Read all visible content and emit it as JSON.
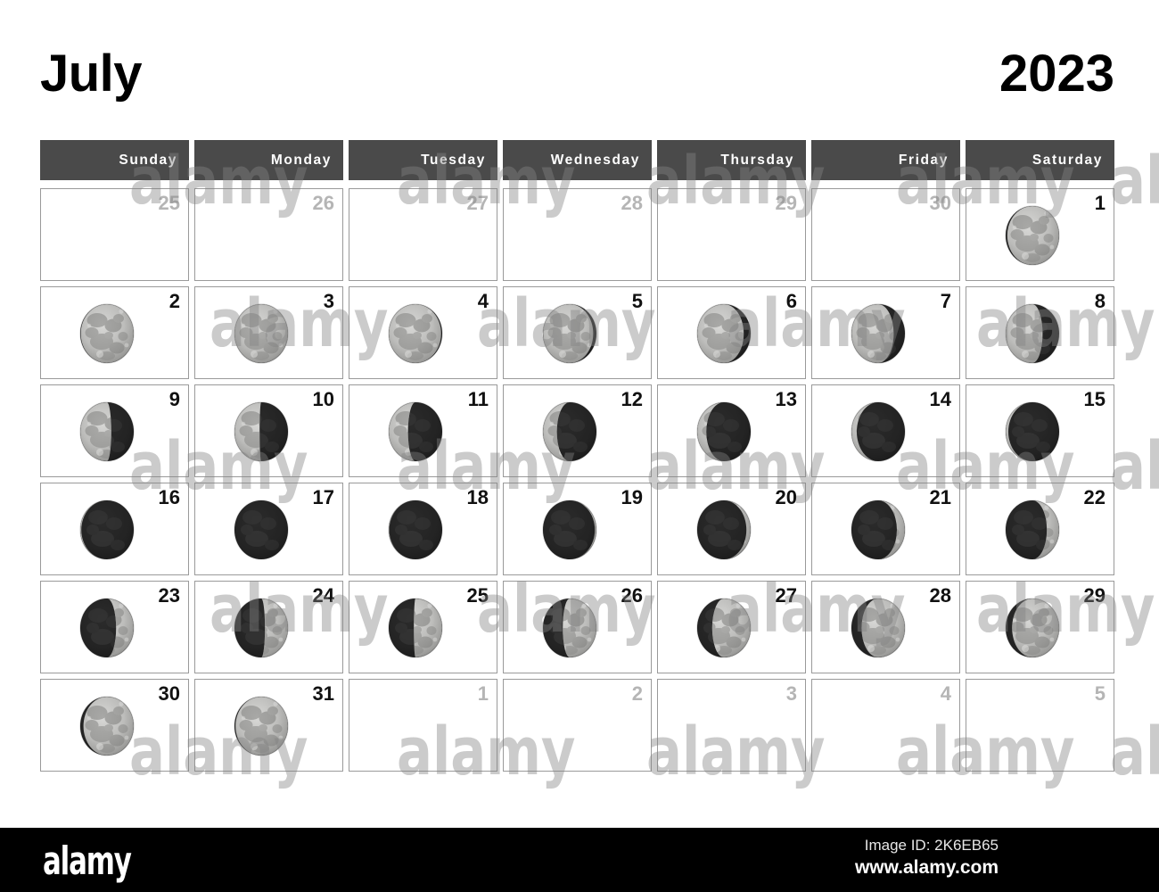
{
  "header": {
    "month": "July",
    "year": "2023"
  },
  "weekdays": [
    "Sunday",
    "Monday",
    "Tuesday",
    "Wednesday",
    "Thursday",
    "Friday",
    "Saturday"
  ],
  "colors": {
    "header_bg": "#4a4a4a",
    "header_text": "#ffffff",
    "day_number": "#111111",
    "out_of_month_number": "#b5b5b5",
    "cell_border": "#9a9a9a",
    "page_bg": "#ffffff",
    "footer_bg": "#000000"
  },
  "watermark": {
    "brand": "alamy",
    "tiles": [
      "alamy",
      "alamy",
      "alamy",
      "alamy",
      "alamy",
      "alamy",
      "alamy",
      "alamy",
      "alamy",
      "alamy",
      "alamy",
      "alamy"
    ]
  },
  "footer": {
    "logo": "alamy",
    "image_id": "Image ID: 2K6EB65",
    "url": "www.alamy.com"
  },
  "weeks": [
    [
      {
        "n": "25",
        "out": true,
        "moon": null
      },
      {
        "n": "26",
        "out": true,
        "moon": null
      },
      {
        "n": "27",
        "out": true,
        "moon": null
      },
      {
        "n": "28",
        "out": true,
        "moon": null
      },
      {
        "n": "29",
        "out": true,
        "moon": null
      },
      {
        "n": "30",
        "out": true,
        "moon": null
      },
      {
        "n": "1",
        "out": false,
        "moon": {
          "phase": "waxing-gibbous",
          "illumination": 97,
          "age": 13.1
        }
      }
    ],
    [
      {
        "n": "2",
        "out": false,
        "moon": {
          "phase": "waxing-gibbous",
          "illumination": 99,
          "age": 14.1
        }
      },
      {
        "n": "3",
        "out": false,
        "moon": {
          "phase": "full-moon",
          "illumination": 100,
          "age": 15.1
        }
      },
      {
        "n": "4",
        "out": false,
        "moon": {
          "phase": "waning-gibbous",
          "illumination": 98,
          "age": 16.1
        }
      },
      {
        "n": "5",
        "out": false,
        "moon": {
          "phase": "waning-gibbous",
          "illumination": 94,
          "age": 17.1
        }
      },
      {
        "n": "6",
        "out": false,
        "moon": {
          "phase": "waning-gibbous",
          "illumination": 87,
          "age": 18.1
        }
      },
      {
        "n": "7",
        "out": false,
        "moon": {
          "phase": "waning-gibbous",
          "illumination": 79,
          "age": 19.1
        }
      },
      {
        "n": "8",
        "out": false,
        "moon": {
          "phase": "waning-gibbous",
          "illumination": 69,
          "age": 20.1
        }
      }
    ],
    [
      {
        "n": "9",
        "out": false,
        "moon": {
          "phase": "waning-gibbous",
          "illumination": 58,
          "age": 21.1
        }
      },
      {
        "n": "10",
        "out": false,
        "moon": {
          "phase": "last-quarter",
          "illumination": 47,
          "age": 22.1
        }
      },
      {
        "n": "11",
        "out": false,
        "moon": {
          "phase": "waning-crescent",
          "illumination": 36,
          "age": 23.1
        }
      },
      {
        "n": "12",
        "out": false,
        "moon": {
          "phase": "waning-crescent",
          "illumination": 26,
          "age": 24.1
        }
      },
      {
        "n": "13",
        "out": false,
        "moon": {
          "phase": "waning-crescent",
          "illumination": 17,
          "age": 25.1
        }
      },
      {
        "n": "14",
        "out": false,
        "moon": {
          "phase": "waning-crescent",
          "illumination": 10,
          "age": 26.1
        }
      },
      {
        "n": "15",
        "out": false,
        "moon": {
          "phase": "waning-crescent",
          "illumination": 5,
          "age": 27.1
        }
      }
    ],
    [
      {
        "n": "16",
        "out": false,
        "moon": {
          "phase": "waning-crescent",
          "illumination": 2,
          "age": 28.1
        }
      },
      {
        "n": "17",
        "out": false,
        "moon": {
          "phase": "new-moon",
          "illumination": 0,
          "age": 29.2
        }
      },
      {
        "n": "18",
        "out": false,
        "moon": {
          "phase": "new-moon",
          "illumination": 1,
          "age": 0.6
        }
      },
      {
        "n": "19",
        "out": false,
        "moon": {
          "phase": "waxing-crescent",
          "illumination": 3,
          "age": 1.6
        }
      },
      {
        "n": "20",
        "out": false,
        "moon": {
          "phase": "waxing-crescent",
          "illumination": 8,
          "age": 2.6
        }
      },
      {
        "n": "21",
        "out": false,
        "moon": {
          "phase": "waxing-crescent",
          "illumination": 15,
          "age": 3.6
        }
      },
      {
        "n": "22",
        "out": false,
        "moon": {
          "phase": "waxing-crescent",
          "illumination": 23,
          "age": 4.6
        }
      }
    ],
    [
      {
        "n": "23",
        "out": false,
        "moon": {
          "phase": "waxing-crescent",
          "illumination": 33,
          "age": 5.6
        }
      },
      {
        "n": "24",
        "out": false,
        "moon": {
          "phase": "waxing-crescent",
          "illumination": 43,
          "age": 6.6
        }
      },
      {
        "n": "25",
        "out": false,
        "moon": {
          "phase": "first-quarter",
          "illumination": 53,
          "age": 7.6
        }
      },
      {
        "n": "26",
        "out": false,
        "moon": {
          "phase": "first-quarter",
          "illumination": 63,
          "age": 8.6
        }
      },
      {
        "n": "27",
        "out": false,
        "moon": {
          "phase": "waxing-gibbous",
          "illumination": 72,
          "age": 9.6
        }
      },
      {
        "n": "28",
        "out": false,
        "moon": {
          "phase": "waxing-gibbous",
          "illumination": 81,
          "age": 10.6
        }
      },
      {
        "n": "29",
        "out": false,
        "moon": {
          "phase": "waxing-gibbous",
          "illumination": 88,
          "age": 11.6
        }
      }
    ],
    [
      {
        "n": "30",
        "out": false,
        "moon": {
          "phase": "waxing-gibbous",
          "illumination": 94,
          "age": 12.6
        }
      },
      {
        "n": "31",
        "out": false,
        "moon": {
          "phase": "waxing-gibbous",
          "illumination": 98,
          "age": 13.6
        }
      },
      {
        "n": "1",
        "out": true,
        "moon": null
      },
      {
        "n": "2",
        "out": true,
        "moon": null
      },
      {
        "n": "3",
        "out": true,
        "moon": null
      },
      {
        "n": "4",
        "out": true,
        "moon": null
      },
      {
        "n": "5",
        "out": true,
        "moon": null
      }
    ]
  ]
}
